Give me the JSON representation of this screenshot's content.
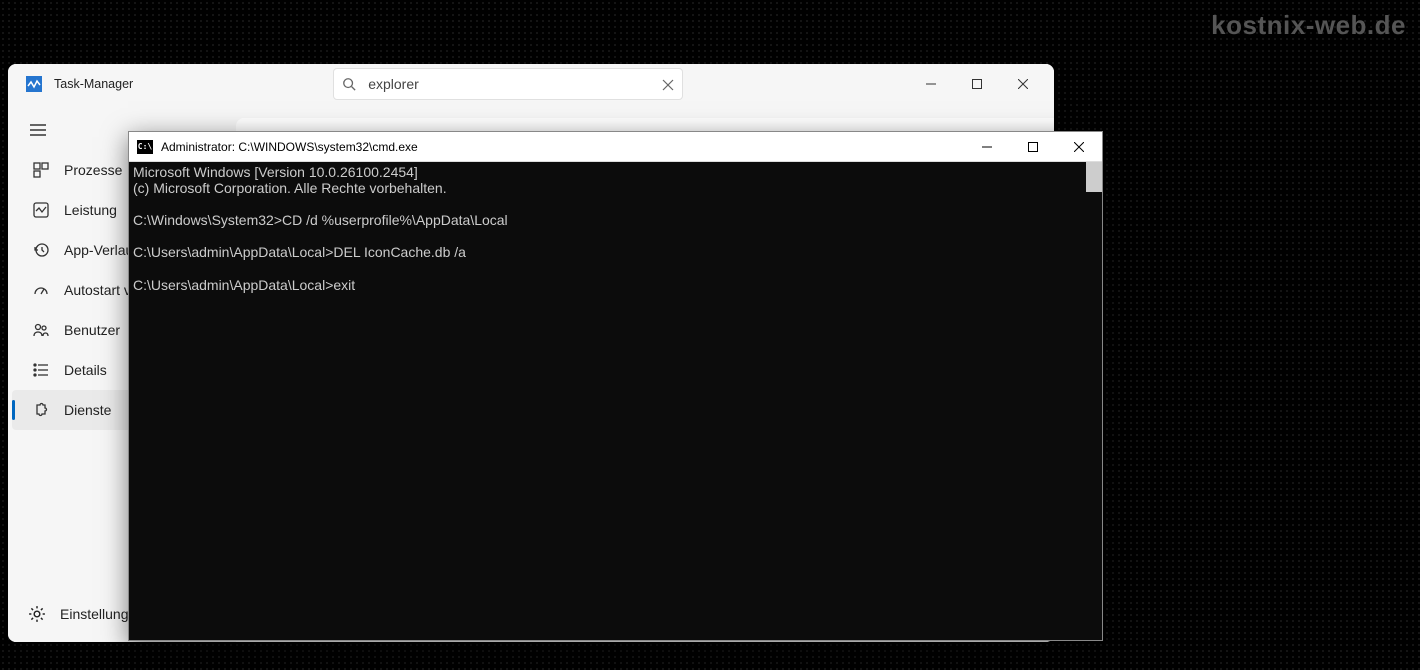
{
  "watermark": "kostnix-web.de",
  "taskmgr": {
    "title": "Task-Manager",
    "search_value": "explorer",
    "nav": [
      {
        "label": "Prozesse"
      },
      {
        "label": "Leistung"
      },
      {
        "label": "App-Verlauf"
      },
      {
        "label": "Autostart von Apps"
      },
      {
        "label": "Benutzer"
      },
      {
        "label": "Details"
      },
      {
        "label": "Dienste"
      }
    ],
    "settings_label": "Einstellungen"
  },
  "cmd": {
    "title": "Administrator: C:\\WINDOWS\\system32\\cmd.exe",
    "lines": [
      "Microsoft Windows [Version 10.0.26100.2454]",
      "(c) Microsoft Corporation. Alle Rechte vorbehalten.",
      "",
      "C:\\Windows\\System32>CD /d %userprofile%\\AppData\\Local",
      "",
      "C:\\Users\\admin\\AppData\\Local>DEL IconCache.db /a",
      "",
      "C:\\Users\\admin\\AppData\\Local>exit"
    ]
  }
}
